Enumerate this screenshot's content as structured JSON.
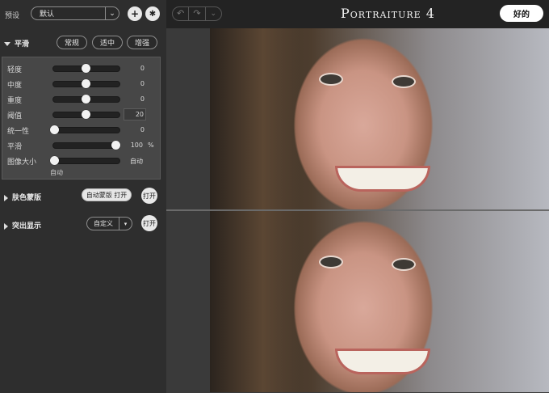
{
  "preset": {
    "label": "预设",
    "value": "默认"
  },
  "app": {
    "title": "Portraiture 4",
    "ok_label": "好的"
  },
  "smoothing": {
    "title": "平滑",
    "modes": [
      "常规",
      "适中",
      "增强"
    ],
    "sliders": [
      {
        "label": "轻度",
        "value": "0",
        "fraction": 0.5
      },
      {
        "label": "中度",
        "value": "0",
        "fraction": 0.5
      },
      {
        "label": "重度",
        "value": "0",
        "fraction": 0.5
      },
      {
        "label": "阈值",
        "value": "20",
        "fraction": 0.5
      },
      {
        "label": "统一性",
        "value": "0",
        "fraction": 0.0
      },
      {
        "label": "平滑",
        "value": "100",
        "unit": "%",
        "fraction": 1.0
      },
      {
        "label": "图像大小",
        "value": "自动",
        "fraction": 0.0
      }
    ],
    "image_size_note": "自动"
  },
  "skin_mask": {
    "title": "肤色蒙版",
    "button_label": "自动蒙版 打开",
    "toggle_label": "打开"
  },
  "enhance": {
    "title": "突出显示",
    "select_value": "自定义",
    "toggle_label": "打开"
  }
}
